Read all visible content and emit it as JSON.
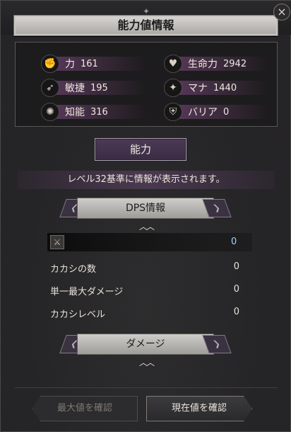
{
  "window": {
    "title": "能力値情報",
    "close_icon": "×"
  },
  "stats": [
    {
      "icon": "fist-icon",
      "glyph": "✊",
      "label": "力",
      "value": "161"
    },
    {
      "icon": "heart-shield-icon",
      "glyph": "♥",
      "label": "生命力",
      "value": "2942"
    },
    {
      "icon": "boot-icon",
      "glyph": "➶",
      "label": "敏捷",
      "value": "195"
    },
    {
      "icon": "mana-icon",
      "glyph": "✦",
      "label": "マナ",
      "value": "1440"
    },
    {
      "icon": "sun-icon",
      "glyph": "✺",
      "label": "知能",
      "value": "316"
    },
    {
      "icon": "barrier-icon",
      "glyph": "⛨",
      "label": "バリア",
      "value": "0"
    }
  ],
  "tab": {
    "label": "能力"
  },
  "notice": "レベル32基準に情報が表示されます。",
  "dps_section": {
    "title": "DPS情報",
    "weapon_value": "0",
    "rows": [
      {
        "label": "カカシの数",
        "value": "0"
      },
      {
        "label": "単一最大ダメージ",
        "value": "0"
      },
      {
        "label": "カカシレベル",
        "value": "0"
      }
    ]
  },
  "damage_section": {
    "title": "ダメージ"
  },
  "buttons": {
    "max_confirm": "最大値を確認",
    "current_confirm": "現在値を確認"
  },
  "colors": {
    "accent_purple": "#4d3a56",
    "weapon_value": "#9bd3ff"
  }
}
